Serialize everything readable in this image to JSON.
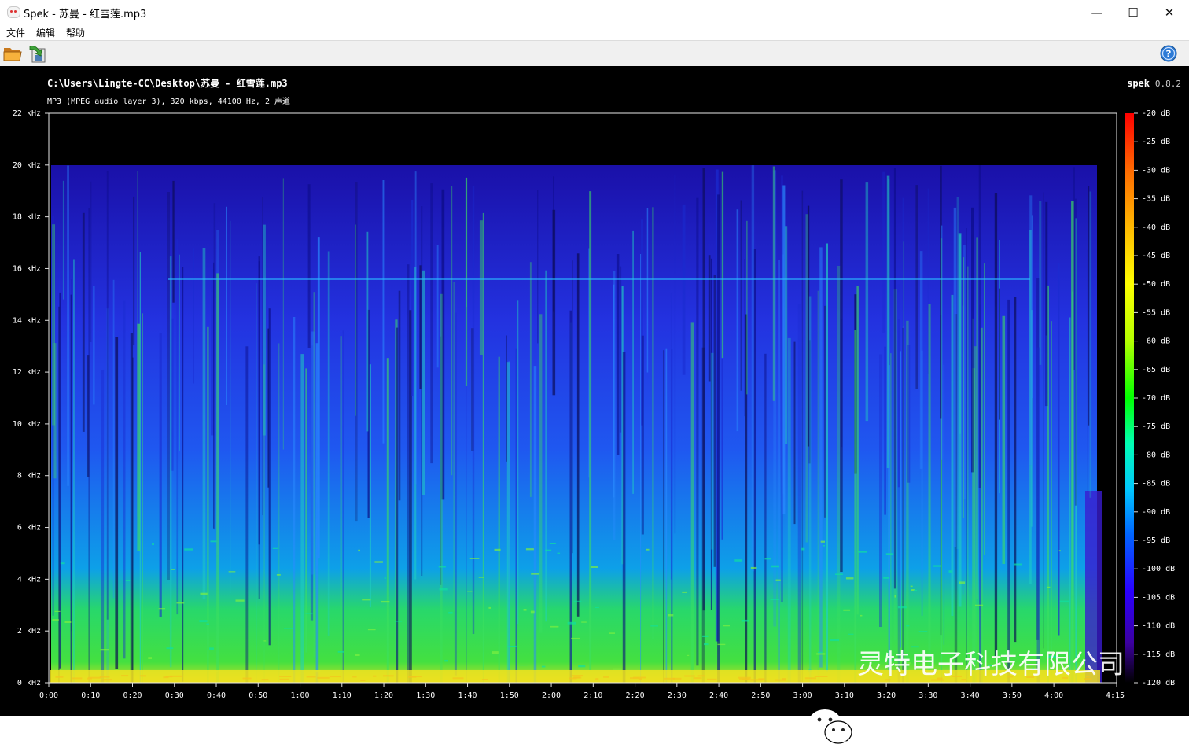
{
  "window": {
    "title": "Spek - 苏曼 - 红雪莲.mp3",
    "minimize": "—",
    "maximize": "☐",
    "close": "✕"
  },
  "menu": [
    "文件",
    "编辑",
    "帮助"
  ],
  "toolbar": {
    "open_icon": "folder-open-icon",
    "save_icon": "save-export-icon",
    "help_icon": "help-icon",
    "help_glyph": "?"
  },
  "header": {
    "file_path": "C:\\Users\\Lingte-CC\\Desktop\\苏曼 - 红雪莲.mp3",
    "file_info": "MP3 (MPEG audio layer 3), 320 kbps, 44100 Hz, 2 声道",
    "brand": "spek",
    "version": "0.8.2"
  },
  "spectrogram": {
    "y_labels": [
      "0 kHz",
      "2 kHz",
      "4 kHz",
      "6 kHz",
      "8 kHz",
      "10 kHz",
      "12 kHz",
      "14 kHz",
      "16 kHz",
      "18 kHz",
      "20 kHz",
      "22 kHz"
    ],
    "x_labels": [
      "0:00",
      "0:10",
      "0:20",
      "0:30",
      "0:40",
      "0:50",
      "1:00",
      "1:10",
      "1:20",
      "1:30",
      "1:40",
      "1:50",
      "2:00",
      "2:10",
      "2:20",
      "2:30",
      "2:40",
      "2:50",
      "3:00",
      "3:10",
      "3:20",
      "3:30",
      "3:40",
      "3:50",
      "4:00"
    ],
    "x_end_label": "4:15",
    "db_labels": [
      "-20 dB",
      "-25 dB",
      "-30 dB",
      "-35 dB",
      "-40 dB",
      "-45 dB",
      "-50 dB",
      "-55 dB",
      "-60 dB",
      "-65 dB",
      "-70 dB",
      "-75 dB",
      "-80 dB",
      "-85 dB",
      "-90 dB",
      "-95 dB",
      "-100 dB",
      "-105 dB",
      "-110 dB",
      "-115 dB",
      "-120 dB"
    ],
    "colors": [
      "#ff0000",
      "#ff6a00",
      "#ffc800",
      "#ffff00",
      "#b4ff00",
      "#00ff00",
      "#00ffb4",
      "#00c8ff",
      "#0064ff",
      "#2a00ff",
      "#3c00a0",
      "#000000"
    ]
  },
  "watermark": {
    "icon": "wechat-icon",
    "text": "灵特电子科技有限公司"
  }
}
